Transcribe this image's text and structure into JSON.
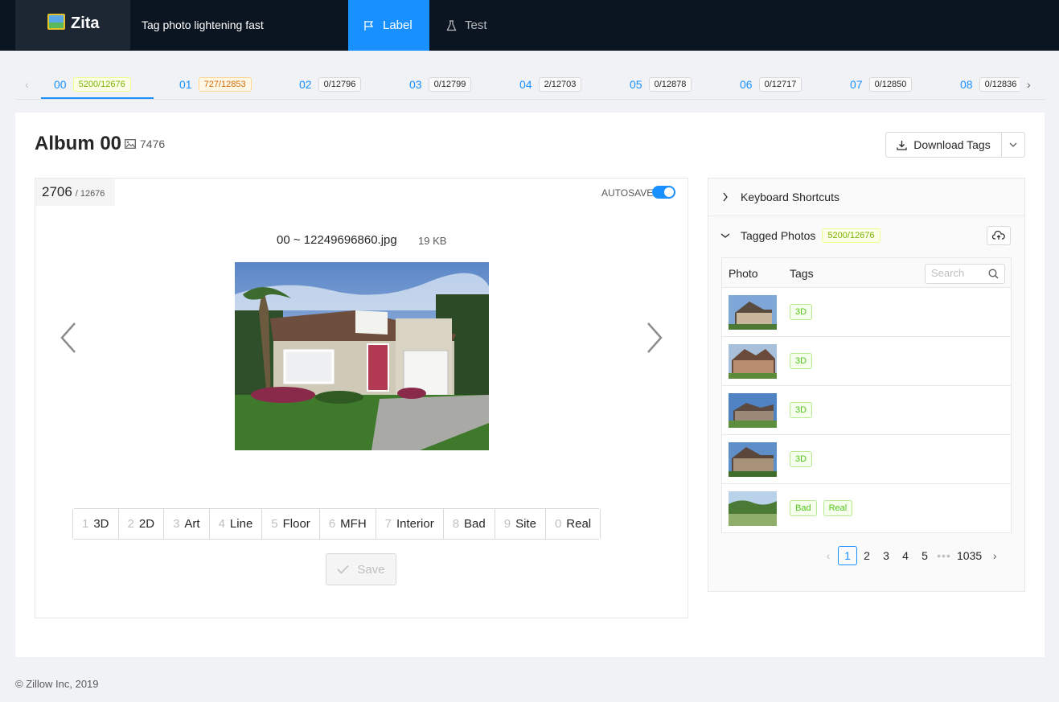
{
  "app": {
    "name": "Zita",
    "tagline": "Tag photo lightening fast",
    "nav": [
      {
        "label": "Label"
      },
      {
        "label": "Test"
      }
    ]
  },
  "albums": [
    {
      "num": "00",
      "count": "5200/12676",
      "style": "green"
    },
    {
      "num": "01",
      "count": "727/12853",
      "style": "orange"
    },
    {
      "num": "02",
      "count": "0/12796",
      "style": "default"
    },
    {
      "num": "03",
      "count": "0/12799",
      "style": "default"
    },
    {
      "num": "04",
      "count": "2/12703",
      "style": "default"
    },
    {
      "num": "05",
      "count": "0/12878",
      "style": "default"
    },
    {
      "num": "06",
      "count": "0/12717",
      "style": "default"
    },
    {
      "num": "07",
      "count": "0/12850",
      "style": "default"
    },
    {
      "num": "08",
      "count": "0/12836",
      "style": "default"
    }
  ],
  "album": {
    "title": "Album 00",
    "photo_count": "7476",
    "download_label": "Download Tags"
  },
  "viewer": {
    "current": "2706",
    "total": "/ 12676",
    "autosave_label": "AUTOSAVE",
    "autosave_on": true,
    "filename": "00 ~ 12249696860.jpg",
    "filesize": "19 KB",
    "tags": [
      {
        "key": "1",
        "label": "3D"
      },
      {
        "key": "2",
        "label": "2D"
      },
      {
        "key": "3",
        "label": "Art"
      },
      {
        "key": "4",
        "label": "Line"
      },
      {
        "key": "5",
        "label": "Floor"
      },
      {
        "key": "6",
        "label": "MFH"
      },
      {
        "key": "7",
        "label": "Interior"
      },
      {
        "key": "8",
        "label": "Bad"
      },
      {
        "key": "9",
        "label": "Site"
      },
      {
        "key": "0",
        "label": "Real"
      }
    ],
    "save_label": "Save"
  },
  "sidebar": {
    "shortcuts_label": "Keyboard Shortcuts",
    "tagged_label": "Tagged Photos",
    "tagged_count": "5200/12676",
    "table": {
      "col_photo": "Photo",
      "col_tags": "Tags",
      "search_placeholder": "Search",
      "rows": [
        {
          "tags": [
            "3D"
          ]
        },
        {
          "tags": [
            "3D"
          ]
        },
        {
          "tags": [
            "3D"
          ]
        },
        {
          "tags": [
            "3D"
          ]
        },
        {
          "tags": [
            "Bad",
            "Real"
          ]
        }
      ]
    },
    "pagination": {
      "pages": [
        "1",
        "2",
        "3",
        "4",
        "5"
      ],
      "ellipsis": "•••",
      "last": "1035",
      "current": "1"
    }
  },
  "footer": "© Zillow Inc, 2019",
  "colors": {
    "primary": "#1890ff",
    "header_bg": "#0b1521",
    "tag_green": "#52c41a"
  }
}
